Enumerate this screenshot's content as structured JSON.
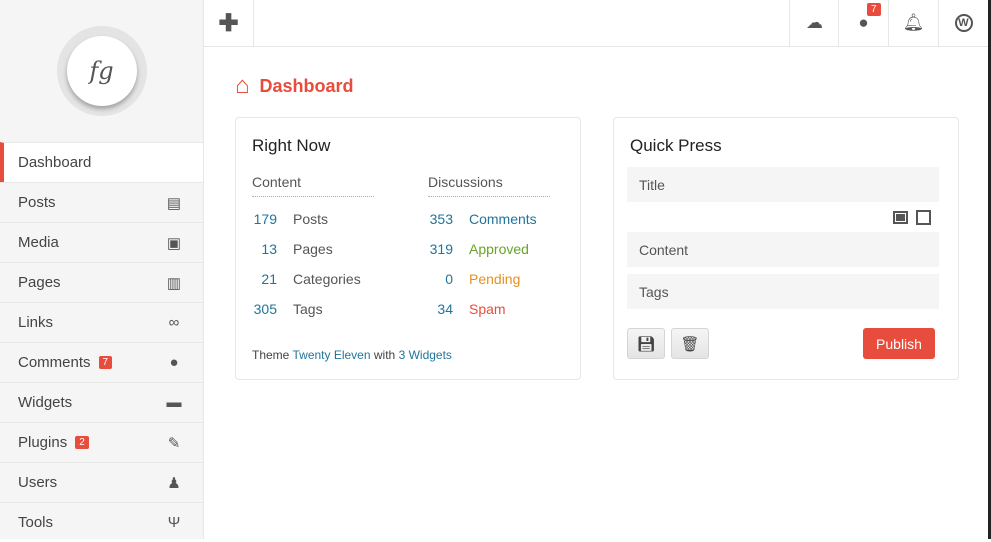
{
  "sidebar": {
    "logo": "fg",
    "items": [
      {
        "label": "Dashboard",
        "icon": "dashboard-icon",
        "glyph": ""
      },
      {
        "label": "Posts",
        "icon": "posts-icon",
        "glyph": "▤"
      },
      {
        "label": "Media",
        "icon": "image-icon",
        "glyph": "▣"
      },
      {
        "label": "Pages",
        "icon": "pages-icon",
        "glyph": "▥"
      },
      {
        "label": "Links",
        "icon": "link-icon",
        "glyph": "∞"
      },
      {
        "label": "Comments",
        "icon": "comments-icon",
        "glyph": "●",
        "badge": "7"
      },
      {
        "label": "Widgets",
        "icon": "widgets-icon",
        "glyph": "▬"
      },
      {
        "label": "Plugins",
        "icon": "plug-icon",
        "glyph": "✎",
        "badge": "2"
      },
      {
        "label": "Users",
        "icon": "user-icon",
        "glyph": "♟"
      },
      {
        "label": "Tools",
        "icon": "tools-icon",
        "glyph": "Ψ"
      }
    ]
  },
  "topbar": {
    "comments_badge": "7"
  },
  "page": {
    "title": "Dashboard"
  },
  "right_now": {
    "title": "Right Now",
    "content_header": "Content",
    "discussions_header": "Discussions",
    "content": [
      {
        "n": "179",
        "label": "Posts"
      },
      {
        "n": "13",
        "label": "Pages"
      },
      {
        "n": "21",
        "label": "Categories"
      },
      {
        "n": "305",
        "label": "Tags"
      }
    ],
    "discussions": [
      {
        "n": "353",
        "label": "Comments",
        "color": "#21759b"
      },
      {
        "n": "319",
        "label": "Approved",
        "color": "#6aa329"
      },
      {
        "n": "0",
        "label": "Pending",
        "color": "#e6911e"
      },
      {
        "n": "34",
        "label": "Spam",
        "color": "#e74c3c"
      }
    ],
    "theme_prefix": "Theme",
    "theme_name": "Twenty Eleven",
    "theme_mid": "with",
    "widgets": "3 Widgets"
  },
  "quick_press": {
    "title": "Quick Press",
    "title_placeholder": "Title",
    "content_placeholder": "Content",
    "tags_placeholder": "Tags",
    "publish": "Publish"
  },
  "colors": {
    "accent": "#e74c3c",
    "link": "#21759b"
  }
}
